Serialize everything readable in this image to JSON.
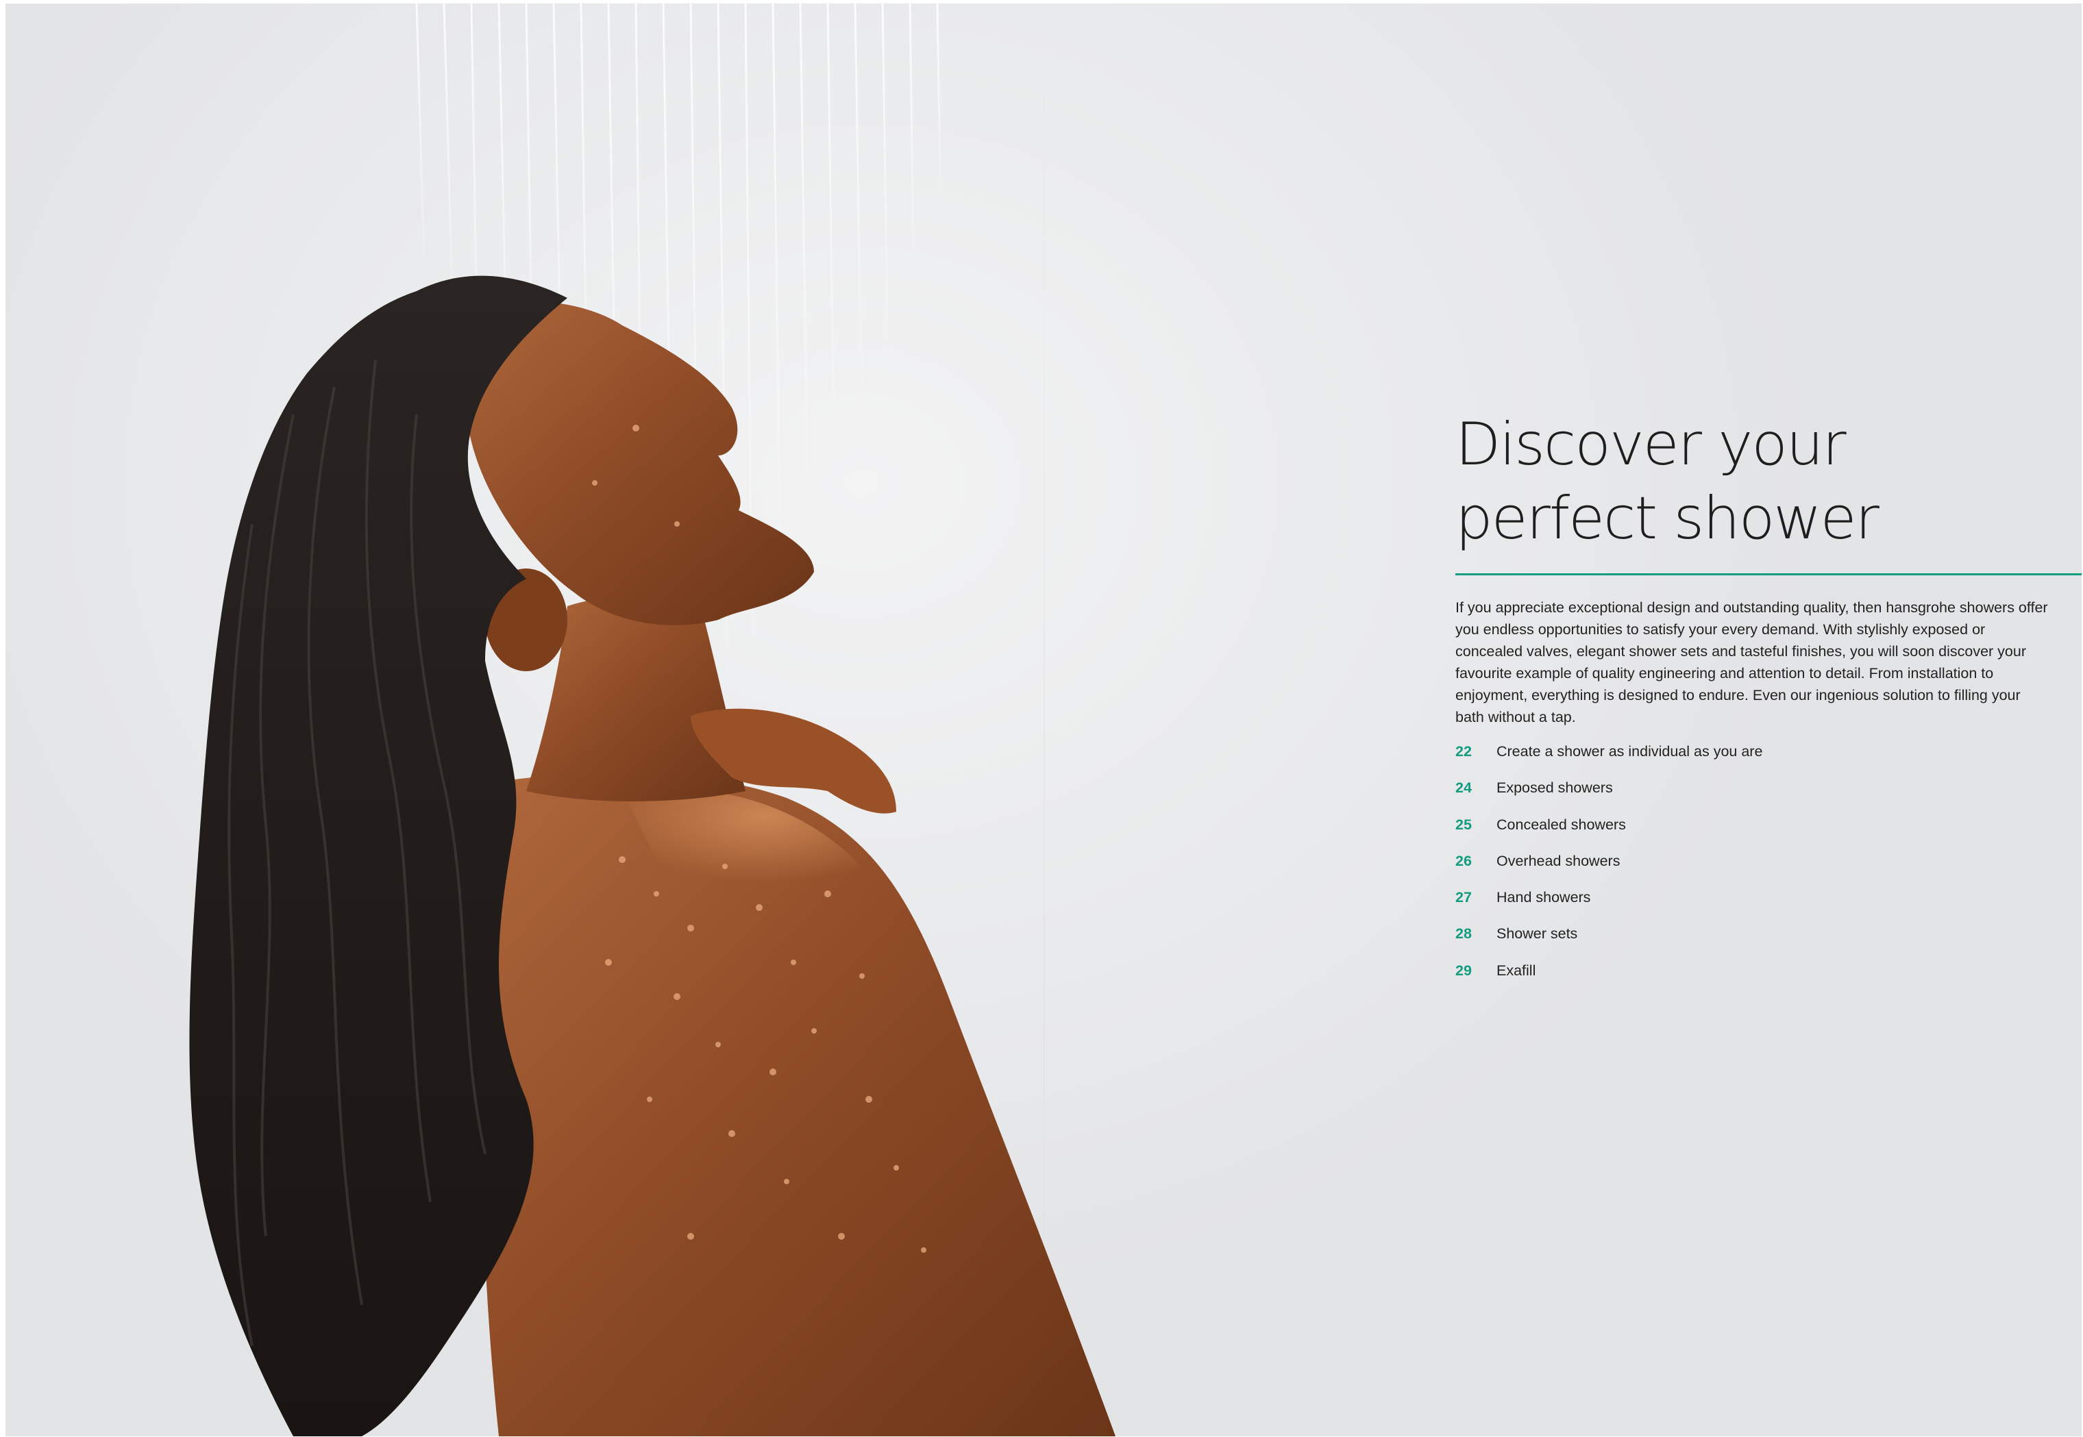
{
  "page": {
    "title": "Discover your perfect shower",
    "intro": "If you appreciate exceptional design and outstanding quality, then hansgrohe showers offer you endless opportunities to satisfy your every demand. With stylishly exposed or concealed valves, elegant shower sets and tasteful finishes, you will soon discover your favourite example of quality engineering and attention to detail. From installation to enjoyment, everything is designed to endure. Even our ingenious solution to filling your bath without a tap.",
    "accent_color": "#139c7f"
  },
  "contents": [
    {
      "page": "22",
      "label": "Create a shower as individual as you are"
    },
    {
      "page": "24",
      "label": "Exposed showers"
    },
    {
      "page": "25",
      "label": "Concealed showers"
    },
    {
      "page": "26",
      "label": "Overhead showers"
    },
    {
      "page": "27",
      "label": "Hand showers"
    },
    {
      "page": "28",
      "label": "Shower sets"
    },
    {
      "page": "29",
      "label": "Exafill"
    }
  ]
}
